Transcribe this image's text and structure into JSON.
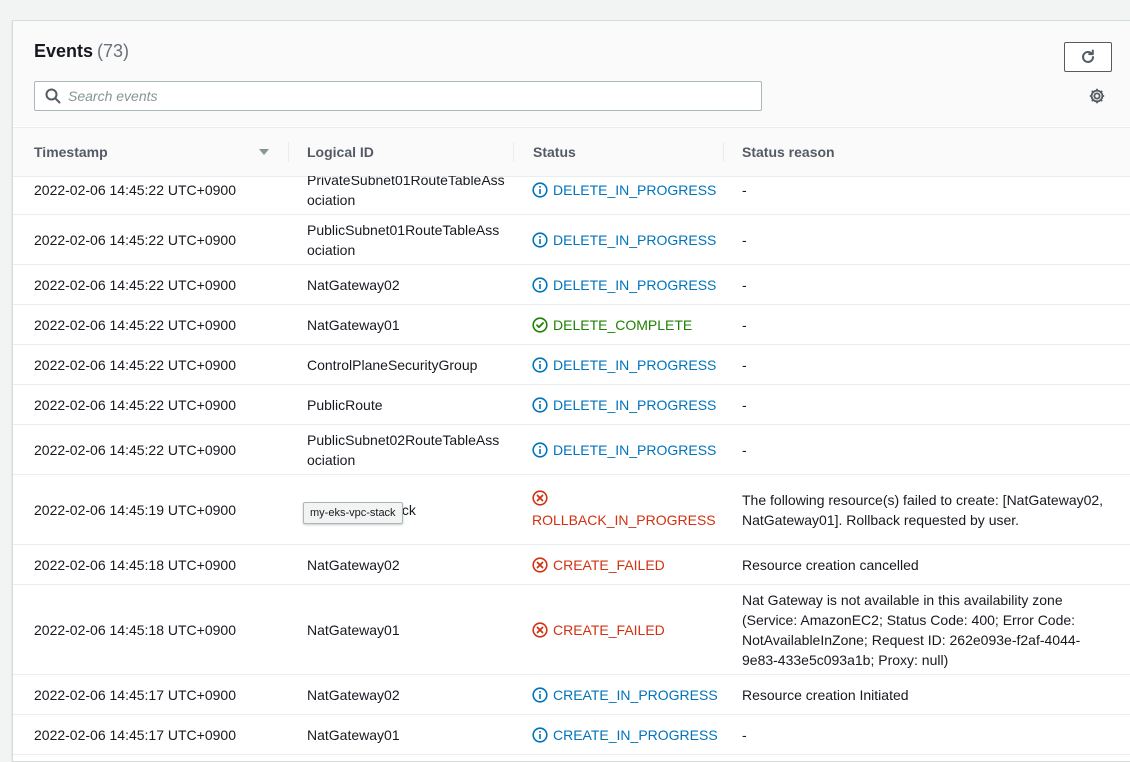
{
  "events": {
    "title": "Events",
    "count": "(73)",
    "search_placeholder": "Search events",
    "columns": {
      "timestamp": "Timestamp",
      "logical_id": "Logical ID",
      "status": "Status",
      "status_reason": "Status reason"
    },
    "rows": [
      {
        "timestamp": "2022-02-06 14:45:22 UTC+0900",
        "logical_id": "PrivateSubnet01RouteTableAssociation",
        "status": "DELETE_IN_PROGRESS",
        "reason": "-"
      },
      {
        "timestamp": "2022-02-06 14:45:22 UTC+0900",
        "logical_id": "PublicSubnet01RouteTableAssociation",
        "status": "DELETE_IN_PROGRESS",
        "reason": "-"
      },
      {
        "timestamp": "2022-02-06 14:45:22 UTC+0900",
        "logical_id": "NatGateway02",
        "status": "DELETE_IN_PROGRESS",
        "reason": "-"
      },
      {
        "timestamp": "2022-02-06 14:45:22 UTC+0900",
        "logical_id": "NatGateway01",
        "status": "DELETE_COMPLETE",
        "reason": "-"
      },
      {
        "timestamp": "2022-02-06 14:45:22 UTC+0900",
        "logical_id": "ControlPlaneSecurityGroup",
        "status": "DELETE_IN_PROGRESS",
        "reason": "-"
      },
      {
        "timestamp": "2022-02-06 14:45:22 UTC+0900",
        "logical_id": "PublicRoute",
        "status": "DELETE_IN_PROGRESS",
        "reason": "-"
      },
      {
        "timestamp": "2022-02-06 14:45:22 UTC+0900",
        "logical_id": "PublicSubnet02RouteTableAssociation",
        "status": "DELETE_IN_PROGRESS",
        "reason": "-"
      },
      {
        "timestamp": "2022-02-06 14:45:19 UTC+0900",
        "logical_id": "my-eks-vpc-stack",
        "status": "ROLLBACK_IN_PROGRESS",
        "reason": "The following resource(s) failed to create: [NatGateway02, NatGateway01]. Rollback requested by user."
      },
      {
        "timestamp": "2022-02-06 14:45:18 UTC+0900",
        "logical_id": "NatGateway02",
        "status": "CREATE_FAILED",
        "reason": "Resource creation cancelled"
      },
      {
        "timestamp": "2022-02-06 14:45:18 UTC+0900",
        "logical_id": "NatGateway01",
        "status": "CREATE_FAILED",
        "reason": "Nat Gateway is not available in this availability zone (Service: AmazonEC2; Status Code: 400; Error Code: NotAvailableInZone; Request ID: 262e093e-f2af-4044-9e83-433e5c093a1b; Proxy: null)"
      },
      {
        "timestamp": "2022-02-06 14:45:17 UTC+0900",
        "logical_id": "NatGateway02",
        "status": "CREATE_IN_PROGRESS",
        "reason": "Resource creation Initiated"
      },
      {
        "timestamp": "2022-02-06 14:45:17 UTC+0900",
        "logical_id": "NatGateway01",
        "status": "CREATE_IN_PROGRESS",
        "reason": "-"
      }
    ],
    "tooltip": "my-eks-vpc-stack"
  },
  "colors": {
    "info": "#0073bb",
    "success": "#1d8102",
    "error": "#d13212"
  }
}
